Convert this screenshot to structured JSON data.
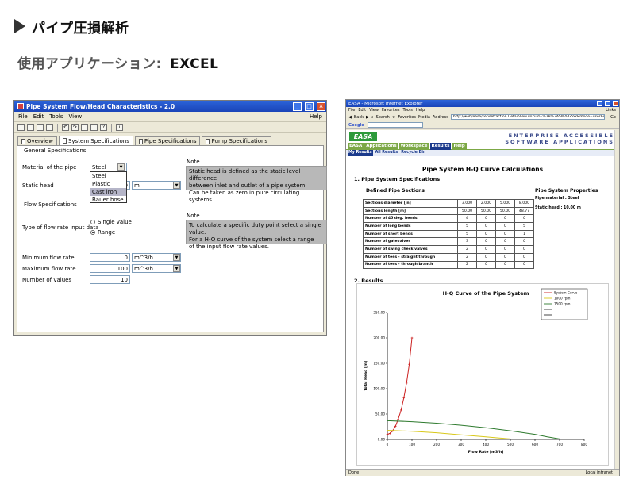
{
  "header": {
    "title": "パイプ圧損解析",
    "subtitle_label": "使用アプリケーション:",
    "subtitle_app": "EXCEL"
  },
  "app": {
    "title": "Pipe System Flow/Head Characteristics - 2.0",
    "menu": [
      "File",
      "Edit",
      "Tools",
      "View"
    ],
    "help": "Help",
    "tabs": [
      "Overview",
      "System Specifications",
      "Pipe Specifications",
      "Pump Specifications"
    ],
    "general": {
      "label": "General Specifications",
      "material_label": "Material of the pipe",
      "material_value": "Steel",
      "material_options": [
        "Steel",
        "Plastic",
        "Cast iron",
        "Bauer hose"
      ],
      "static_label": "Static head",
      "static_value": "0",
      "static_unit": "m",
      "note_title": "Note",
      "note_lines": [
        "Static head is defined as the static level difference",
        "between inlet and outlet of a pipe system.",
        "Can be taken as zero in pure circulating systems."
      ]
    },
    "flow": {
      "label": "Flow Specifications",
      "type_label": "Type of flow rate input data",
      "radio_single": "Single value",
      "radio_range": "Range",
      "note_title": "Note",
      "note_lines": [
        "To calculate a specific duty point select a single value.",
        "For a H-Q curve of the system select a range",
        "of the input flow rate values."
      ],
      "min_label": "Minimum flow rate",
      "min_value": "0",
      "max_label": "Maximum flow rate",
      "max_value": "100",
      "unit": "m^3/h",
      "num_label": "Number of values",
      "num_value": "10"
    }
  },
  "browser": {
    "title": "EASA - Microsoft Internet Explorer",
    "menu": [
      "File",
      "Edit",
      "View",
      "Favorites",
      "Tools",
      "Help"
    ],
    "nav_back": "Back",
    "nav_search": "Search",
    "nav_favorites": "Favorites",
    "nav_media": "Media",
    "address_label": "Address",
    "address": "http://web/easa/servlet/action.DetailView.do?uid=%2B%3ASW4-G5W&mode=user&mysql&run=1&any",
    "go": "Go",
    "links": "Links",
    "google": "Google",
    "status_left": "Done",
    "status_zone": "Local intranet",
    "easa_logo": "EASA",
    "easa_tag1": "ENTERPRISE ACCESSIBLE",
    "easa_tag2": "SOFTWARE APPLICATIONS",
    "nav": [
      "EASA",
      "Applications",
      "Workspace",
      "Results",
      "Help"
    ],
    "subnav": [
      "My Results",
      "All Results",
      "Recycle Bin"
    ],
    "page_title": "Pipe System H-Q Curve Calculations",
    "sec1": "1.  Pipe System Specifications",
    "defined_title": "Defined Pipe Sections",
    "props_title": "Pipe System Properties",
    "prop_material": "Pipe material : Steel",
    "prop_static": "Static head :  10.00 m",
    "table": [
      [
        "Sections diameter [in]",
        "3.000",
        "2.000",
        "5.000",
        "8.000"
      ],
      [
        "Sections length [m]",
        "50.00",
        "50.00",
        "50.00",
        "48.77"
      ],
      [
        "Number of 45 deg. bends",
        "4",
        "0",
        "0",
        "0"
      ],
      [
        "Number of long bends",
        "5",
        "0",
        "0",
        "5"
      ],
      [
        "Number of short bends",
        "5",
        "0",
        "0",
        "1"
      ],
      [
        "Number of gatevalves",
        "3",
        "0",
        "0",
        "0"
      ],
      [
        "Number of swing check valves",
        "2",
        "0",
        "0",
        "0"
      ],
      [
        "Number of tees - straight through",
        "2",
        "0",
        "0",
        "0"
      ],
      [
        "Number of tees - through branch",
        "2",
        "0",
        "0",
        "0"
      ]
    ],
    "sec2": "2.  Results"
  },
  "chart_data": {
    "type": "line",
    "title": "H-Q Curve of the Pipe System",
    "xlabel": "Flow Rate [m3/h]",
    "ylabel": "Total Head [m]",
    "xlim": [
      0,
      800
    ],
    "ylim": [
      0,
      250
    ],
    "xticks": [
      0,
      100,
      200,
      300,
      400,
      500,
      600,
      700,
      800
    ],
    "yticks": [
      0,
      50,
      100,
      150,
      200,
      250
    ],
    "ytick_labels": [
      "0.00",
      "50.00",
      "100.00",
      "150.00",
      "200.00",
      "250.00"
    ],
    "legend_position": "top-right",
    "series": [
      {
        "name": "System Curve",
        "color": "#cc2222",
        "markers": true,
        "x": [
          0,
          11,
          22,
          33,
          44,
          56,
          67,
          78,
          89,
          100
        ],
        "y": [
          10,
          12,
          17,
          26,
          40,
          58,
          82,
          111,
          148,
          200
        ]
      },
      {
        "name": "1000 rpm",
        "color": "#d8c81a",
        "markers": false,
        "x": [
          0,
          100,
          200,
          300,
          400,
          450,
          500
        ],
        "y": [
          18,
          16,
          13,
          9,
          5,
          3,
          1
        ]
      },
      {
        "name": "1500 rpm",
        "color": "#2e7a2e",
        "markers": false,
        "x": [
          0,
          100,
          200,
          300,
          400,
          500,
          600,
          650,
          700
        ],
        "y": [
          37,
          35,
          32,
          28,
          23,
          17,
          10,
          5,
          1
        ]
      },
      {
        "name": "",
        "color": "#333333",
        "markers": false,
        "x": [],
        "y": []
      },
      {
        "name": "",
        "color": "#333333",
        "markers": false,
        "x": [],
        "y": []
      }
    ]
  }
}
